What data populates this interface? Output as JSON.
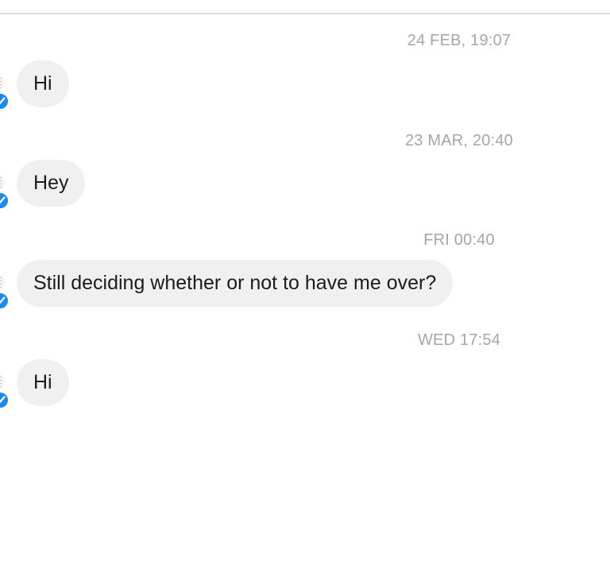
{
  "thread": {
    "messages": [
      {
        "timestamp": "24 FEB, 19:07",
        "text": "Hi"
      },
      {
        "timestamp": "23 MAR, 20:40",
        "text": "Hey"
      },
      {
        "timestamp": "FRI 00:40",
        "text": "Still deciding whether or not to have me over?"
      },
      {
        "timestamp": "WED 17:54",
        "text": "Hi"
      }
    ]
  },
  "colors": {
    "bubble_background": "#f1f0f0",
    "timestamp_text": "#a6a6a6",
    "verified_badge": "#1b8af3",
    "message_text": "#1c1c1c"
  },
  "icons": {
    "avatar": "profile-avatar-icon",
    "badge": "messenger-verified-checkmark-icon"
  }
}
